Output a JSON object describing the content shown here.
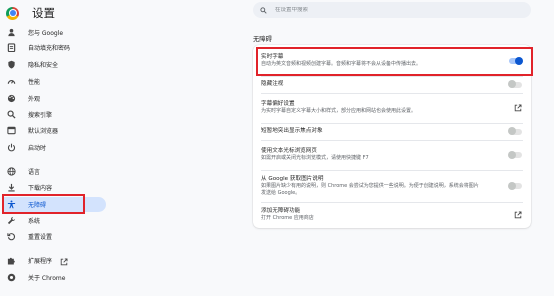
{
  "app": {
    "title": "设置"
  },
  "search": {
    "placeholder": "在设置中搜索"
  },
  "sidebar": {
    "items": [
      {
        "label": "您与 Google",
        "icon": "person-icon"
      },
      {
        "label": "自动填充和密码",
        "icon": "clipboard-icon"
      },
      {
        "label": "隐私和安全",
        "icon": "shield-icon"
      },
      {
        "label": "性能",
        "icon": "speedometer-icon"
      },
      {
        "label": "外观",
        "icon": "palette-icon"
      },
      {
        "label": "搜索引擎",
        "icon": "search-icon"
      },
      {
        "label": "默认浏览器",
        "icon": "browser-icon"
      },
      {
        "label": "启动时",
        "icon": "power-icon"
      },
      {
        "label": "语言",
        "icon": "globe-icon"
      },
      {
        "label": "下载内容",
        "icon": "download-icon"
      },
      {
        "label": "无障碍",
        "icon": "accessibility-icon",
        "active": true
      },
      {
        "label": "系统",
        "icon": "wrench-icon"
      },
      {
        "label": "重置设置",
        "icon": "reset-icon"
      },
      {
        "label": "扩展程序",
        "icon": "puzzle-icon",
        "external": true
      },
      {
        "label": "关于 Chrome",
        "icon": "chrome-icon"
      }
    ]
  },
  "main": {
    "section_title": "无障碍",
    "settings": [
      {
        "title": "实时字幕",
        "desc": "自动为英文音频和视频创建字幕。音频和字幕将不会从设备中传播出去。",
        "control": "toggle",
        "on": true
      },
      {
        "title": "隐藏注视",
        "desc": "",
        "control": "toggle",
        "on": false
      },
      {
        "title": "字幕偏好设置",
        "desc": "为实时字幕自定义字幕大小和样式，部分应用和网站也会使用此设置。",
        "control": "open"
      },
      {
        "title": "短暂地突出显示焦点对象",
        "desc": "",
        "control": "toggle",
        "on": false
      },
      {
        "title": "使用文本光标浏览网页",
        "desc": "如需开启或关闭光标浏览模式，请使用快捷键 F7",
        "control": "toggle",
        "on": false
      },
      {
        "title": "从 Google 获取图片说明",
        "desc": "如果图片缺少有用的说明，则 Chrome 会尝试为您提供一些说明。为便于创建说明，系统会将图片发送给 Google。",
        "control": "toggle",
        "on": false
      },
      {
        "title": "添加无障碍功能",
        "desc": "打开 Chrome 应用商店",
        "control": "open"
      }
    ]
  },
  "colors": {
    "accent": "#0b57d0",
    "active_bg": "#d3e3fd",
    "highlight": "#e1232a"
  }
}
